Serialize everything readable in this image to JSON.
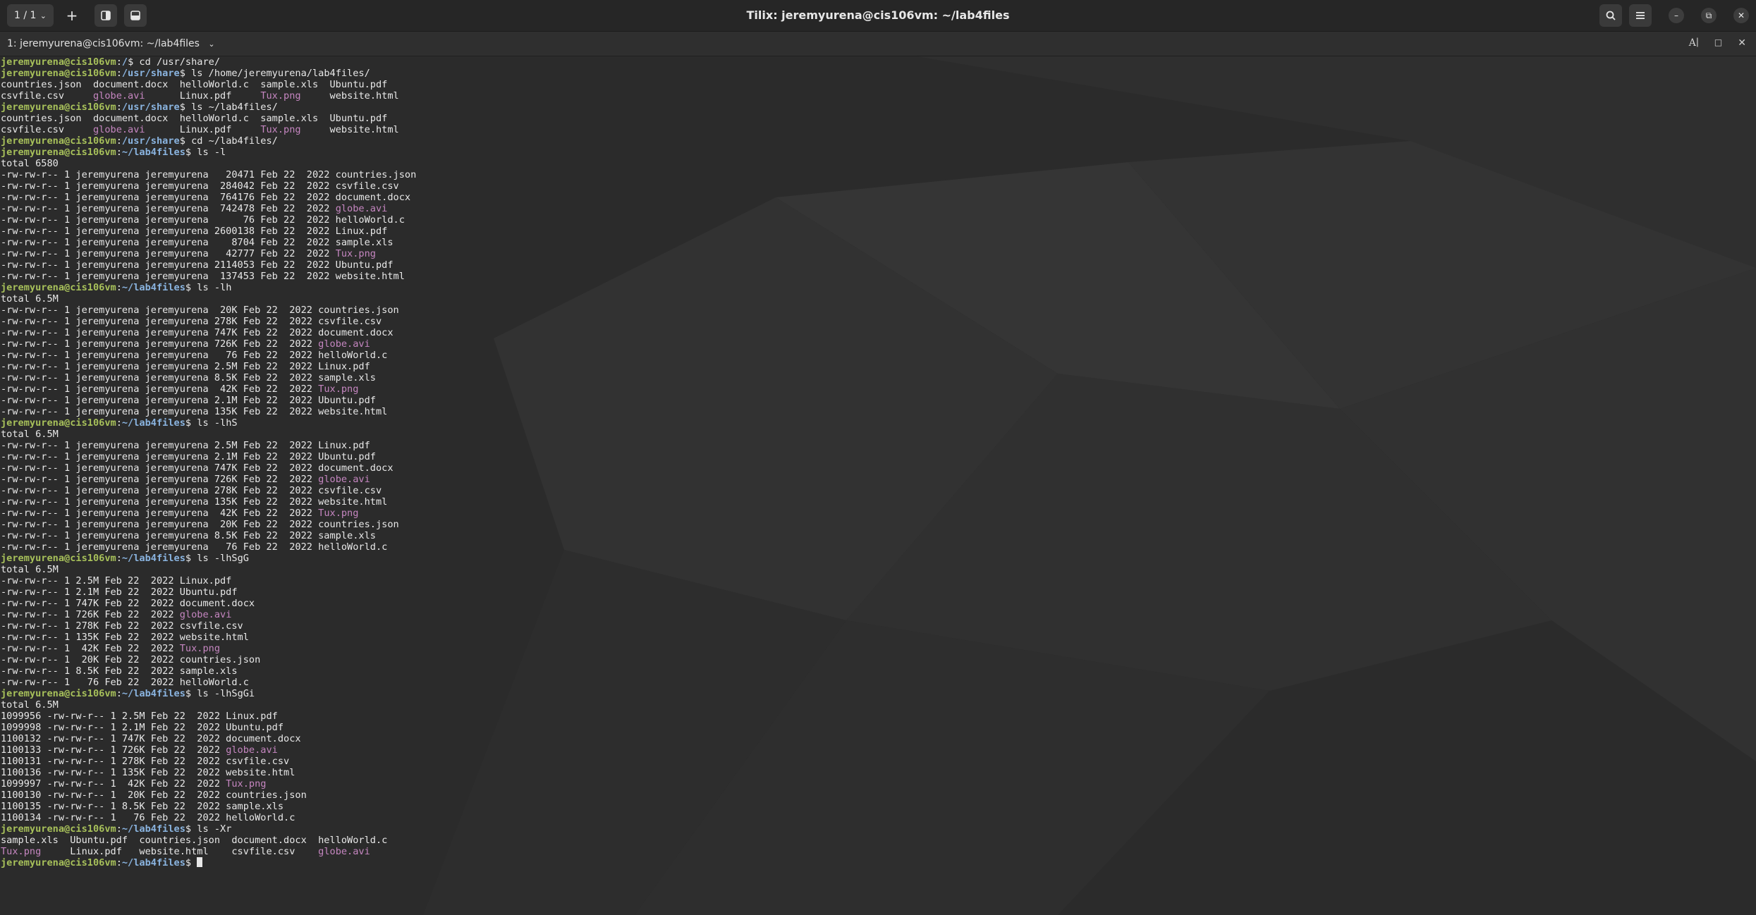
{
  "window": {
    "session_switch": "1 / 1",
    "title": "Tilix: jeremyurena@cis106vm: ~/lab4files",
    "terminal_title": "1: jeremyurena@cis106vm: ~/lab4files",
    "icons": [
      "add-icon",
      "split-right-icon",
      "split-down-icon",
      "search-icon",
      "menu-icon",
      "minimize-icon",
      "maximize-icon",
      "close-icon",
      "font-icon",
      "maximize-terminal-icon",
      "close-terminal-icon"
    ]
  },
  "colors": {
    "prompt_user": "#a7c05a",
    "prompt_path": "#8ab4e0",
    "media_file": "#c586c0"
  },
  "terminal": {
    "lines": [
      [
        {
          "t": "jeremyurena@cis106vm",
          "c": "pu"
        },
        {
          "t": ":"
        },
        {
          "t": "/",
          "c": "pp"
        },
        {
          "t": "$ cd /usr/share/"
        }
      ],
      [
        {
          "t": "jeremyurena@cis106vm",
          "c": "pu"
        },
        {
          "t": ":"
        },
        {
          "t": "/usr/share",
          "c": "pp"
        },
        {
          "t": "$ ls /home/jeremyurena/lab4files/"
        }
      ],
      [
        {
          "t": "countries.json  document.docx  helloWorld.c  sample.xls  Ubuntu.pdf"
        }
      ],
      [
        {
          "t": "csvfile.csv     "
        },
        {
          "t": "globe.avi",
          "c": "mag"
        },
        {
          "t": "      Linux.pdf     "
        },
        {
          "t": "Tux.png",
          "c": "mag"
        },
        {
          "t": "     website.html"
        }
      ],
      [
        {
          "t": "jeremyurena@cis106vm",
          "c": "pu"
        },
        {
          "t": ":"
        },
        {
          "t": "/usr/share",
          "c": "pp"
        },
        {
          "t": "$ ls ~/lab4files/"
        }
      ],
      [
        {
          "t": "countries.json  document.docx  helloWorld.c  sample.xls  Ubuntu.pdf"
        }
      ],
      [
        {
          "t": "csvfile.csv     "
        },
        {
          "t": "globe.avi",
          "c": "mag"
        },
        {
          "t": "      Linux.pdf     "
        },
        {
          "t": "Tux.png",
          "c": "mag"
        },
        {
          "t": "     website.html"
        }
      ],
      [
        {
          "t": "jeremyurena@cis106vm",
          "c": "pu"
        },
        {
          "t": ":"
        },
        {
          "t": "/usr/share",
          "c": "pp"
        },
        {
          "t": "$ cd ~/lab4files/"
        }
      ],
      [
        {
          "t": "jeremyurena@cis106vm",
          "c": "pu"
        },
        {
          "t": ":"
        },
        {
          "t": "~/lab4files",
          "c": "pp"
        },
        {
          "t": "$ ls -l"
        }
      ],
      [
        {
          "t": "total 6580"
        }
      ],
      [
        {
          "t": "-rw-rw-r-- 1 jeremyurena jeremyurena   20471 Feb 22  2022 countries.json"
        }
      ],
      [
        {
          "t": "-rw-rw-r-- 1 jeremyurena jeremyurena  284042 Feb 22  2022 csvfile.csv"
        }
      ],
      [
        {
          "t": "-rw-rw-r-- 1 jeremyurena jeremyurena  764176 Feb 22  2022 document.docx"
        }
      ],
      [
        {
          "t": "-rw-rw-r-- 1 jeremyurena jeremyurena  742478 Feb 22  2022 "
        },
        {
          "t": "globe.avi",
          "c": "mag"
        }
      ],
      [
        {
          "t": "-rw-rw-r-- 1 jeremyurena jeremyurena      76 Feb 22  2022 helloWorld.c"
        }
      ],
      [
        {
          "t": "-rw-rw-r-- 1 jeremyurena jeremyurena 2600138 Feb 22  2022 Linux.pdf"
        }
      ],
      [
        {
          "t": "-rw-rw-r-- 1 jeremyurena jeremyurena    8704 Feb 22  2022 sample.xls"
        }
      ],
      [
        {
          "t": "-rw-rw-r-- 1 jeremyurena jeremyurena   42777 Feb 22  2022 "
        },
        {
          "t": "Tux.png",
          "c": "mag"
        }
      ],
      [
        {
          "t": "-rw-rw-r-- 1 jeremyurena jeremyurena 2114053 Feb 22  2022 Ubuntu.pdf"
        }
      ],
      [
        {
          "t": "-rw-rw-r-- 1 jeremyurena jeremyurena  137453 Feb 22  2022 website.html"
        }
      ],
      [
        {
          "t": "jeremyurena@cis106vm",
          "c": "pu"
        },
        {
          "t": ":"
        },
        {
          "t": "~/lab4files",
          "c": "pp"
        },
        {
          "t": "$ ls -lh"
        }
      ],
      [
        {
          "t": "total 6.5M"
        }
      ],
      [
        {
          "t": "-rw-rw-r-- 1 jeremyurena jeremyurena  20K Feb 22  2022 countries.json"
        }
      ],
      [
        {
          "t": "-rw-rw-r-- 1 jeremyurena jeremyurena 278K Feb 22  2022 csvfile.csv"
        }
      ],
      [
        {
          "t": "-rw-rw-r-- 1 jeremyurena jeremyurena 747K Feb 22  2022 document.docx"
        }
      ],
      [
        {
          "t": "-rw-rw-r-- 1 jeremyurena jeremyurena 726K Feb 22  2022 "
        },
        {
          "t": "globe.avi",
          "c": "mag"
        }
      ],
      [
        {
          "t": "-rw-rw-r-- 1 jeremyurena jeremyurena   76 Feb 22  2022 helloWorld.c"
        }
      ],
      [
        {
          "t": "-rw-rw-r-- 1 jeremyurena jeremyurena 2.5M Feb 22  2022 Linux.pdf"
        }
      ],
      [
        {
          "t": "-rw-rw-r-- 1 jeremyurena jeremyurena 8.5K Feb 22  2022 sample.xls"
        }
      ],
      [
        {
          "t": "-rw-rw-r-- 1 jeremyurena jeremyurena  42K Feb 22  2022 "
        },
        {
          "t": "Tux.png",
          "c": "mag"
        }
      ],
      [
        {
          "t": "-rw-rw-r-- 1 jeremyurena jeremyurena 2.1M Feb 22  2022 Ubuntu.pdf"
        }
      ],
      [
        {
          "t": "-rw-rw-r-- 1 jeremyurena jeremyurena 135K Feb 22  2022 website.html"
        }
      ],
      [
        {
          "t": "jeremyurena@cis106vm",
          "c": "pu"
        },
        {
          "t": ":"
        },
        {
          "t": "~/lab4files",
          "c": "pp"
        },
        {
          "t": "$ ls -lhS"
        }
      ],
      [
        {
          "t": "total 6.5M"
        }
      ],
      [
        {
          "t": "-rw-rw-r-- 1 jeremyurena jeremyurena 2.5M Feb 22  2022 Linux.pdf"
        }
      ],
      [
        {
          "t": "-rw-rw-r-- 1 jeremyurena jeremyurena 2.1M Feb 22  2022 Ubuntu.pdf"
        }
      ],
      [
        {
          "t": "-rw-rw-r-- 1 jeremyurena jeremyurena 747K Feb 22  2022 document.docx"
        }
      ],
      [
        {
          "t": "-rw-rw-r-- 1 jeremyurena jeremyurena 726K Feb 22  2022 "
        },
        {
          "t": "globe.avi",
          "c": "mag"
        }
      ],
      [
        {
          "t": "-rw-rw-r-- 1 jeremyurena jeremyurena 278K Feb 22  2022 csvfile.csv"
        }
      ],
      [
        {
          "t": "-rw-rw-r-- 1 jeremyurena jeremyurena 135K Feb 22  2022 website.html"
        }
      ],
      [
        {
          "t": "-rw-rw-r-- 1 jeremyurena jeremyurena  42K Feb 22  2022 "
        },
        {
          "t": "Tux.png",
          "c": "mag"
        }
      ],
      [
        {
          "t": "-rw-rw-r-- 1 jeremyurena jeremyurena  20K Feb 22  2022 countries.json"
        }
      ],
      [
        {
          "t": "-rw-rw-r-- 1 jeremyurena jeremyurena 8.5K Feb 22  2022 sample.xls"
        }
      ],
      [
        {
          "t": "-rw-rw-r-- 1 jeremyurena jeremyurena   76 Feb 22  2022 helloWorld.c"
        }
      ],
      [
        {
          "t": "jeremyurena@cis106vm",
          "c": "pu"
        },
        {
          "t": ":"
        },
        {
          "t": "~/lab4files",
          "c": "pp"
        },
        {
          "t": "$ ls -lhSgG"
        }
      ],
      [
        {
          "t": "total 6.5M"
        }
      ],
      [
        {
          "t": "-rw-rw-r-- 1 2.5M Feb 22  2022 Linux.pdf"
        }
      ],
      [
        {
          "t": "-rw-rw-r-- 1 2.1M Feb 22  2022 Ubuntu.pdf"
        }
      ],
      [
        {
          "t": "-rw-rw-r-- 1 747K Feb 22  2022 document.docx"
        }
      ],
      [
        {
          "t": "-rw-rw-r-- 1 726K Feb 22  2022 "
        },
        {
          "t": "globe.avi",
          "c": "mag"
        }
      ],
      [
        {
          "t": "-rw-rw-r-- 1 278K Feb 22  2022 csvfile.csv"
        }
      ],
      [
        {
          "t": "-rw-rw-r-- 1 135K Feb 22  2022 website.html"
        }
      ],
      [
        {
          "t": "-rw-rw-r-- 1  42K Feb 22  2022 "
        },
        {
          "t": "Tux.png",
          "c": "mag"
        }
      ],
      [
        {
          "t": "-rw-rw-r-- 1  20K Feb 22  2022 countries.json"
        }
      ],
      [
        {
          "t": "-rw-rw-r-- 1 8.5K Feb 22  2022 sample.xls"
        }
      ],
      [
        {
          "t": "-rw-rw-r-- 1   76 Feb 22  2022 helloWorld.c"
        }
      ],
      [
        {
          "t": "jeremyurena@cis106vm",
          "c": "pu"
        },
        {
          "t": ":"
        },
        {
          "t": "~/lab4files",
          "c": "pp"
        },
        {
          "t": "$ ls -lhSgGi"
        }
      ],
      [
        {
          "t": "total 6.5M"
        }
      ],
      [
        {
          "t": "1099956 -rw-rw-r-- 1 2.5M Feb 22  2022 Linux.pdf"
        }
      ],
      [
        {
          "t": "1099998 -rw-rw-r-- 1 2.1M Feb 22  2022 Ubuntu.pdf"
        }
      ],
      [
        {
          "t": "1100132 -rw-rw-r-- 1 747K Feb 22  2022 document.docx"
        }
      ],
      [
        {
          "t": "1100133 -rw-rw-r-- 1 726K Feb 22  2022 "
        },
        {
          "t": "globe.avi",
          "c": "mag"
        }
      ],
      [
        {
          "t": "1100131 -rw-rw-r-- 1 278K Feb 22  2022 csvfile.csv"
        }
      ],
      [
        {
          "t": "1100136 -rw-rw-r-- 1 135K Feb 22  2022 website.html"
        }
      ],
      [
        {
          "t": "1099997 -rw-rw-r-- 1  42K Feb 22  2022 "
        },
        {
          "t": "Tux.png",
          "c": "mag"
        }
      ],
      [
        {
          "t": "1100130 -rw-rw-r-- 1  20K Feb 22  2022 countries.json"
        }
      ],
      [
        {
          "t": "1100135 -rw-rw-r-- 1 8.5K Feb 22  2022 sample.xls"
        }
      ],
      [
        {
          "t": "1100134 -rw-rw-r-- 1   76 Feb 22  2022 helloWorld.c"
        }
      ],
      [
        {
          "t": "jeremyurena@cis106vm",
          "c": "pu"
        },
        {
          "t": ":"
        },
        {
          "t": "~/lab4files",
          "c": "pp"
        },
        {
          "t": "$ ls -Xr"
        }
      ],
      [
        {
          "t": "sample.xls  Ubuntu.pdf  countries.json  document.docx  helloWorld.c"
        }
      ],
      [
        {
          "t": "Tux.png",
          "c": "mag"
        },
        {
          "t": "     Linux.pdf   website.html    csvfile.csv    "
        },
        {
          "t": "globe.avi",
          "c": "mag"
        }
      ],
      [
        {
          "t": "jeremyurena@cis106vm",
          "c": "pu"
        },
        {
          "t": ":"
        },
        {
          "t": "~/lab4files",
          "c": "pp"
        },
        {
          "t": "$ "
        }
      ]
    ]
  }
}
